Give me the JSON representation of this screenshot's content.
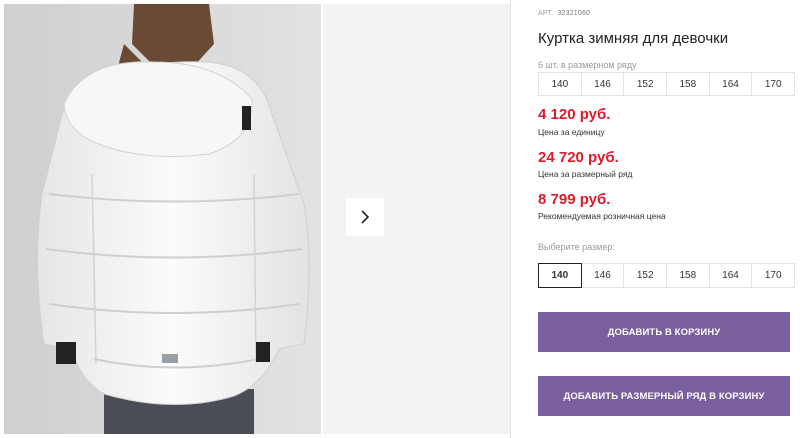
{
  "product": {
    "article_label": "АРТ.",
    "article_number": "32321060",
    "title": "Куртка зимняя для девочки",
    "pack_note": "6 шт. в размерном ряду",
    "size_row": [
      "140",
      "146",
      "152",
      "158",
      "164",
      "170"
    ]
  },
  "prices": [
    {
      "value": "4 120 руб.",
      "caption": "Цена за единицу"
    },
    {
      "value": "24 720 руб.",
      "caption": "Цена за размерный ряд"
    },
    {
      "value": "8 799 руб.",
      "caption": "Рекомендуемая розничная цена"
    }
  ],
  "size_select": {
    "label": "Выберите размер:",
    "options": [
      "140",
      "146",
      "152",
      "158",
      "164",
      "170"
    ],
    "selected": "140"
  },
  "buttons": {
    "add_to_cart": "ДОБАВИТЬ В КОРЗИНУ",
    "add_row_to_cart": "ДОБАВИТЬ РАЗМЕРНЫЙ РЯД В КОРЗИНУ"
  },
  "gallery": {
    "next_icon": "chevron-right-icon"
  },
  "colors": {
    "price": "#e2182b",
    "button": "#7a5f9f",
    "jacket": "#f4f4f4"
  }
}
